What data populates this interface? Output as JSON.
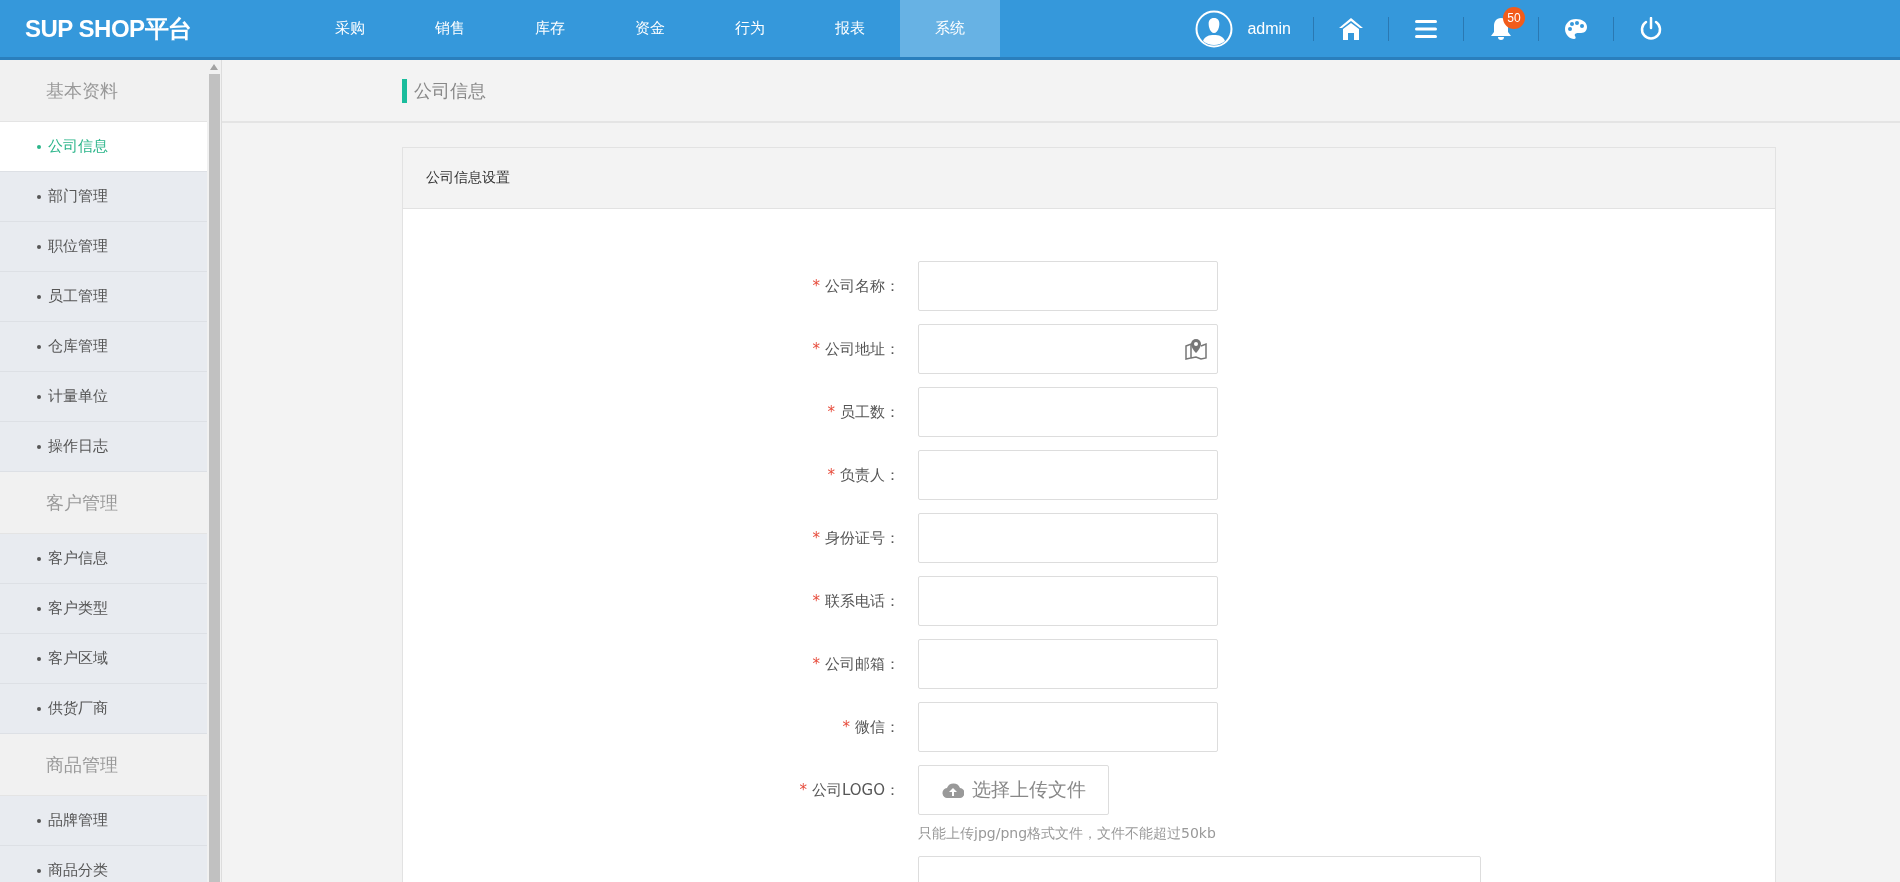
{
  "header": {
    "logo": "SUP SHOP平台",
    "nav": [
      {
        "label": "采购",
        "selected": false
      },
      {
        "label": "销售",
        "selected": false
      },
      {
        "label": "库存",
        "selected": false
      },
      {
        "label": "资金",
        "selected": false
      },
      {
        "label": "行为",
        "selected": false
      },
      {
        "label": "报表",
        "selected": false
      },
      {
        "label": "系统",
        "selected": true
      }
    ],
    "user": "admin",
    "notification_count": "50"
  },
  "sidebar": {
    "groups": [
      {
        "title": "基本资料",
        "items": [
          {
            "label": "公司信息",
            "selected": true
          },
          {
            "label": "部门管理",
            "selected": false
          },
          {
            "label": "职位管理",
            "selected": false
          },
          {
            "label": "员工管理",
            "selected": false
          },
          {
            "label": "仓库管理",
            "selected": false
          },
          {
            "label": "计量单位",
            "selected": false
          },
          {
            "label": "操作日志",
            "selected": false
          }
        ]
      },
      {
        "title": "客户管理",
        "items": [
          {
            "label": "客户信息",
            "selected": false
          },
          {
            "label": "客户类型",
            "selected": false
          },
          {
            "label": "客户区域",
            "selected": false
          },
          {
            "label": "供货厂商",
            "selected": false
          }
        ]
      },
      {
        "title": "商品管理",
        "items": [
          {
            "label": "品牌管理",
            "selected": false
          },
          {
            "label": "商品分类",
            "selected": false
          }
        ]
      }
    ]
  },
  "breadcrumb": "公司信息",
  "card": {
    "title": "公司信息设置",
    "fields": [
      {
        "kind": "text",
        "mark": "*",
        "label": "公司名称："
      },
      {
        "kind": "location",
        "mark": "*",
        "label": "公司地址："
      },
      {
        "kind": "text",
        "mark": "*",
        "label": "员工数："
      },
      {
        "kind": "text",
        "mark": "*",
        "label": "负责人："
      },
      {
        "kind": "text",
        "mark": "*",
        "label": "身份证号："
      },
      {
        "kind": "text",
        "mark": "*",
        "label": "联系电话："
      },
      {
        "kind": "text",
        "mark": "*",
        "label": "公司邮箱："
      },
      {
        "kind": "text",
        "mark": "*",
        "label": "微信："
      },
      {
        "kind": "upload",
        "mark": "*",
        "label": "公司LOGO：",
        "button": "选择上传文件",
        "hint": "只能上传jpg/png格式文件，文件不能超过50kb"
      },
      {
        "kind": "textarea"
      }
    ]
  }
}
